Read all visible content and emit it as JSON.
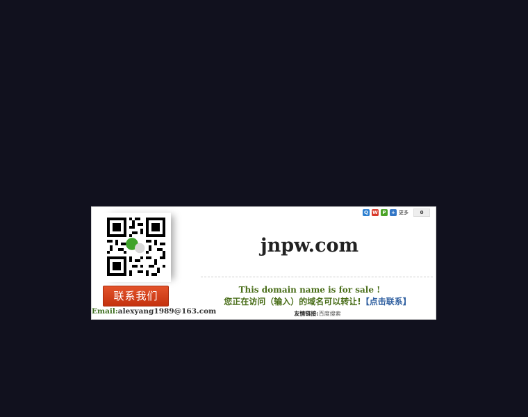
{
  "page": {
    "background": "#11111e"
  },
  "contact": {
    "button_label": "联系我们",
    "email_label": "Email:",
    "email_value": "alexyang1989@163.com"
  },
  "share": {
    "more_label": "更多",
    "count": "0",
    "icons": [
      "qzone-icon",
      "weibo-icon",
      "pengyou-icon",
      "tqq-icon"
    ]
  },
  "domain": {
    "name": "jnpw.com"
  },
  "sale": {
    "english": "This domain name is for sale !",
    "chinese": "您正在访问（输入）的域名可以转让!",
    "contact_link": "【点击联系】"
  },
  "friend_links": {
    "label": "友情链接:",
    "items": [
      "百度搜索"
    ]
  },
  "colors": {
    "accent_green": "#4a6e1a",
    "button_red": "#d4441b",
    "link_blue": "#2f5fa0"
  }
}
